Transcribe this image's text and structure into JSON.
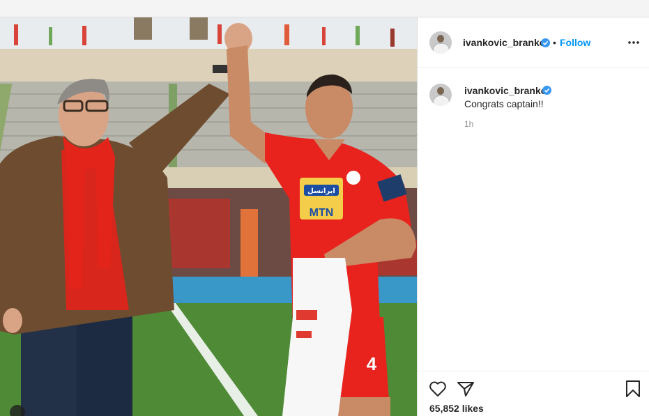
{
  "post": {
    "username": "ivankovic_branko",
    "follow_label": "Follow",
    "bullet": "•",
    "caption_username": "ivankovic_branko",
    "caption_text": "Congrats captain!!",
    "time_ago": "1h",
    "likes": "65,852 likes"
  },
  "photo": {
    "jersey_sponsor": "MTN",
    "sponsor_badge": "ایرانسل",
    "jersey_number": "4"
  },
  "icons": {
    "verified": "verified-badge-icon",
    "more": "more-options-icon",
    "like": "heart-icon",
    "share": "share-icon",
    "save": "bookmark-icon"
  },
  "colors": {
    "accent": "#0095f6",
    "text": "#262626",
    "muted": "#8e8e8e",
    "jersey_red": "#e8231d"
  }
}
